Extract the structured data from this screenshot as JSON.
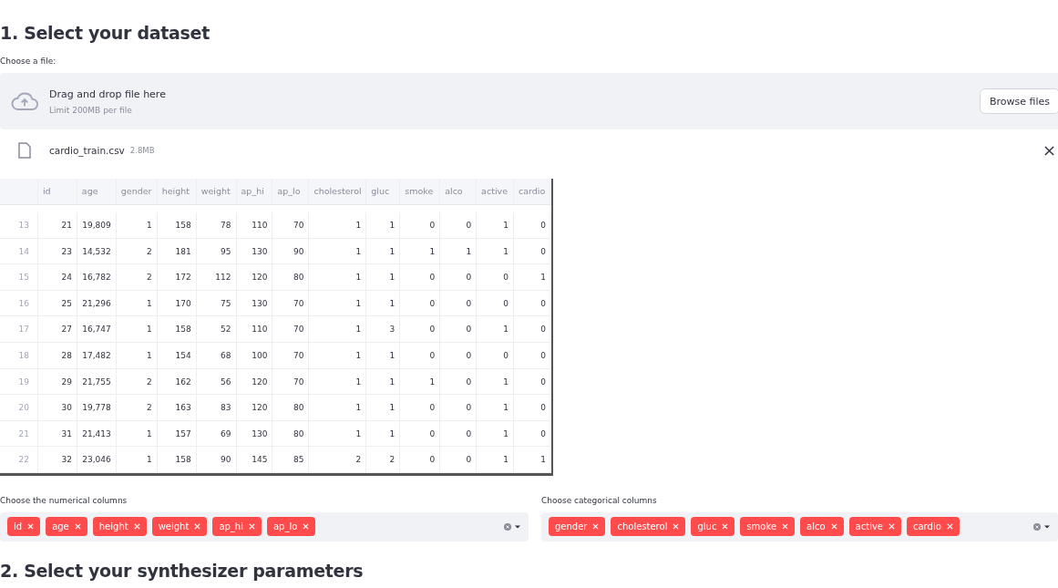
{
  "section_1_title": "1. Select your dataset",
  "uploader": {
    "label": "Choose a file:",
    "instruction": "Drag and drop file here",
    "limit": "Limit 200MB per file",
    "button": "Browse files"
  },
  "uploaded_file": {
    "name": "cardio_train.csv",
    "size": "2.8MB"
  },
  "table": {
    "columns": [
      "",
      "id",
      "age",
      "gender",
      "height",
      "weight",
      "ap_hi",
      "ap_lo",
      "cholesterol",
      "gluc",
      "smoke",
      "alco",
      "active",
      "cardio"
    ],
    "rows": [
      [
        "13",
        "21",
        "19,809",
        "1",
        "158",
        "78",
        "110",
        "70",
        "1",
        "1",
        "0",
        "0",
        "1",
        "0"
      ],
      [
        "14",
        "23",
        "14,532",
        "2",
        "181",
        "95",
        "130",
        "90",
        "1",
        "1",
        "1",
        "1",
        "1",
        "0"
      ],
      [
        "15",
        "24",
        "16,782",
        "2",
        "172",
        "112",
        "120",
        "80",
        "1",
        "1",
        "0",
        "0",
        "0",
        "1"
      ],
      [
        "16",
        "25",
        "21,296",
        "1",
        "170",
        "75",
        "130",
        "70",
        "1",
        "1",
        "0",
        "0",
        "0",
        "0"
      ],
      [
        "17",
        "27",
        "16,747",
        "1",
        "158",
        "52",
        "110",
        "70",
        "1",
        "3",
        "0",
        "0",
        "1",
        "0"
      ],
      [
        "18",
        "28",
        "17,482",
        "1",
        "154",
        "68",
        "100",
        "70",
        "1",
        "1",
        "0",
        "0",
        "0",
        "0"
      ],
      [
        "19",
        "29",
        "21,755",
        "2",
        "162",
        "56",
        "120",
        "70",
        "1",
        "1",
        "1",
        "0",
        "1",
        "0"
      ],
      [
        "20",
        "30",
        "19,778",
        "2",
        "163",
        "83",
        "120",
        "80",
        "1",
        "1",
        "0",
        "0",
        "1",
        "0"
      ],
      [
        "21",
        "31",
        "21,413",
        "1",
        "157",
        "69",
        "130",
        "80",
        "1",
        "1",
        "0",
        "0",
        "1",
        "0"
      ],
      [
        "22",
        "32",
        "23,046",
        "1",
        "158",
        "90",
        "145",
        "85",
        "2",
        "2",
        "0",
        "0",
        "1",
        "1"
      ]
    ]
  },
  "multiselects": [
    {
      "label": "Choose the numerical columns",
      "tags": [
        "id",
        "age",
        "height",
        "weight",
        "ap_hi",
        "ap_lo"
      ]
    },
    {
      "label": "Choose categorical columns",
      "tags": [
        "gender",
        "cholesterol",
        "gluc",
        "smoke",
        "alco",
        "active",
        "cardio"
      ]
    }
  ],
  "section_2_title": "2. Select your synthesizer parameters"
}
